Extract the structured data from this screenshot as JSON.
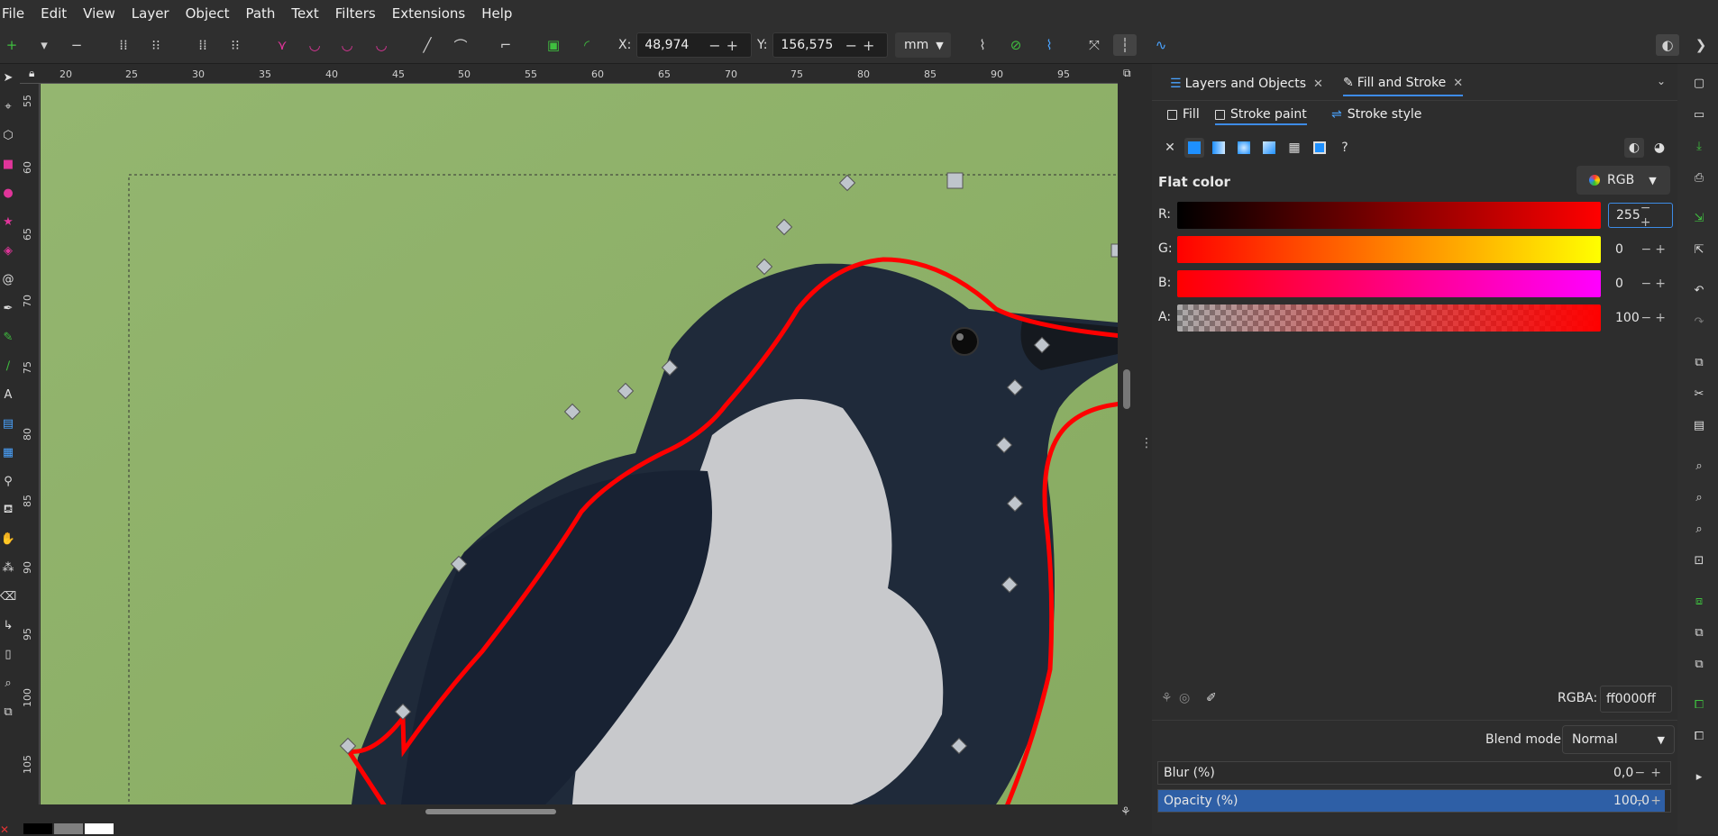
{
  "menu": [
    "File",
    "Edit",
    "View",
    "Layer",
    "Object",
    "Path",
    "Text",
    "Filters",
    "Extensions",
    "Help"
  ],
  "toolbar": {
    "x_label": "X:",
    "x_value": "48,974",
    "y_label": "Y:",
    "y_value": "156,575",
    "unit": "mm"
  },
  "ruler": {
    "top_ticks": [
      "20",
      "25",
      "30",
      "35",
      "40",
      "45",
      "50",
      "55",
      "60",
      "65",
      "70",
      "75",
      "80",
      "85",
      "90",
      "95"
    ],
    "left_ticks": [
      "55",
      "60",
      "65",
      "70",
      "75",
      "80",
      "85",
      "90",
      "95",
      "100",
      "105"
    ]
  },
  "panel": {
    "tabs": [
      {
        "label": "Layers and Objects",
        "icon": "layers-icon"
      },
      {
        "label": "Fill and Stroke",
        "icon": "pen-icon"
      }
    ],
    "subtabs": [
      "Fill",
      "Stroke paint",
      "Stroke style"
    ],
    "paint_heading": "Flat color",
    "color_mode": "RGB",
    "sliders": [
      {
        "label": "R:",
        "value": "255"
      },
      {
        "label": "G:",
        "value": "0"
      },
      {
        "label": "B:",
        "value": "0"
      },
      {
        "label": "A:",
        "value": "100"
      }
    ],
    "rgba_label": "RGBA:",
    "rgba_value": "ff0000ff",
    "blend_label": "Blend mode:",
    "blend_value": "Normal",
    "blur_label": "Blur (%)",
    "blur_value": "0,0",
    "opacity_label": "Opacity (%)",
    "opacity_value": "100,0"
  },
  "colors": {
    "stroke": "#ff0000",
    "accent": "#3d8be6",
    "canvas_bg": "#8fb26a"
  }
}
